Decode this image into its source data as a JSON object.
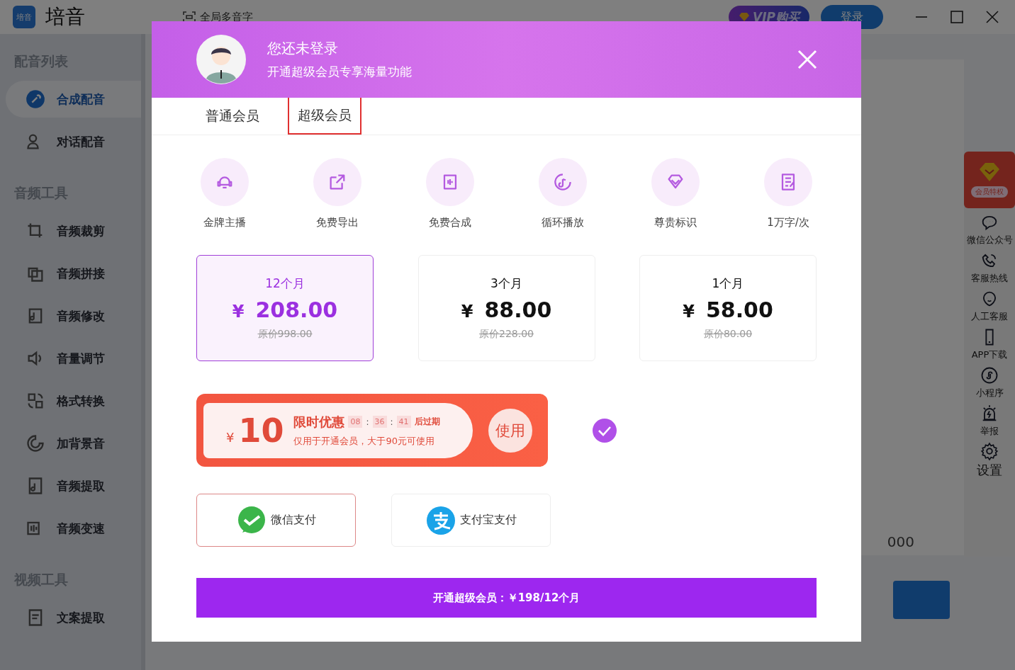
{
  "app": {
    "logo": "培音",
    "title": "培音",
    "polyphone": "全局多音字",
    "vip_button": "VIP购买",
    "login_button": "登录"
  },
  "sidebar": {
    "sections": [
      {
        "title": "配音列表",
        "items": [
          {
            "label": "合成配音",
            "selected": true
          },
          {
            "label": "对话配音",
            "selected": false
          }
        ]
      },
      {
        "title": "音频工具",
        "items": [
          {
            "label": "音频裁剪",
            "selected": false
          },
          {
            "label": "音频拼接",
            "selected": false
          },
          {
            "label": "音频修改",
            "selected": false
          },
          {
            "label": "音量调节",
            "selected": false
          },
          {
            "label": "格式转换",
            "selected": false
          },
          {
            "label": "加背景音",
            "selected": false
          },
          {
            "label": "音频提取",
            "selected": false
          },
          {
            "label": "音频变速",
            "selected": false
          }
        ]
      },
      {
        "title": "视频工具",
        "items": [
          {
            "label": "文案提取",
            "selected": false
          }
        ]
      }
    ]
  },
  "background": {
    "count_fragment": "000"
  },
  "right_panel": {
    "badge": "会员特权",
    "items": [
      "微信公众号",
      "客服热线",
      "人工客服",
      "APP下载",
      "小程序",
      "举报"
    ],
    "settings": "设置"
  },
  "dialog": {
    "title": "您还未登录",
    "subtitle": "开通超级会员专享海量功能",
    "tabs": [
      {
        "label": "普通会员",
        "selected": false
      },
      {
        "label": "超级会员",
        "selected": true
      }
    ],
    "features": [
      "金牌主播",
      "免费导出",
      "免费合成",
      "循环播放",
      "尊贵标识",
      "1万字/次"
    ],
    "plans": [
      {
        "period": "12个月",
        "currency": "¥",
        "price": "208.00",
        "original": "原价998.00",
        "selected": true
      },
      {
        "period": "3个月",
        "currency": "¥",
        "price": "88.00",
        "original": "原价228.00",
        "selected": false
      },
      {
        "period": "1个月",
        "currency": "¥",
        "price": "58.00",
        "original": "原价80.00",
        "selected": false
      }
    ],
    "coupon": {
      "currency": "¥",
      "amount": "10",
      "title": "限时优惠",
      "timer": [
        "08",
        "36",
        "41"
      ],
      "separator": ":",
      "expires": "后过期",
      "note": "仅用于开通会员，大于90元可使用",
      "use_button": "使用",
      "checked": true
    },
    "payments": [
      {
        "label": "微信支付",
        "selected": true
      },
      {
        "label": "支付宝支付",
        "selected": false
      }
    ],
    "submit": "开通超级会员：￥198/12个月"
  }
}
